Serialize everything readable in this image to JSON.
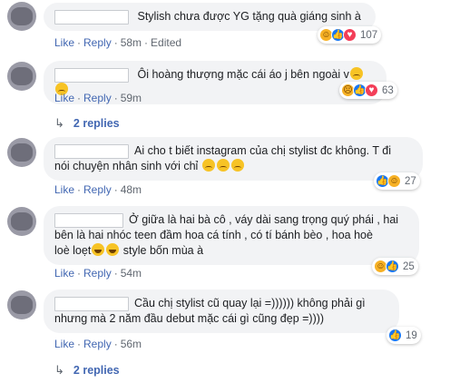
{
  "actions": {
    "like": "Like",
    "reply": "Reply"
  },
  "comments": [
    {
      "text": "Stylish chưa được YG tặng quà giáng sinh à",
      "time": "58m",
      "edited": "Edited",
      "reactions": [
        "haha",
        "like",
        "love"
      ],
      "count": "107"
    },
    {
      "text": "Ôi hoàng thượng mặc cái áo j bên ngoài v",
      "time": "59m",
      "reactions": [
        "sad",
        "like",
        "love"
      ],
      "count": "63",
      "replies": "2 replies"
    },
    {
      "text_line1": "Ai cho t biết instagram của chị stylist đc không. T đi",
      "text_line2": "nói chuyện nhân sinh với chỉ",
      "time": "48m",
      "reactions": [
        "like",
        "haha"
      ],
      "count": "27"
    },
    {
      "text_line1": "Ở giữa là hai bà cô , váy dài sang trọng quý phái , hai",
      "text_line2": "bên là hai nhóc teen đầm hoa cá tính , có tí bánh bèo , hoa hoè",
      "text_line3a": "loè loẹt",
      "text_line3b": "style bốn mùa à",
      "time": "54m",
      "reactions": [
        "haha",
        "like"
      ],
      "count": "25"
    },
    {
      "text_line1": "Cầu chị stylist cũ quay lại =)))))) không phải gì",
      "text_line2": "nhưng mà 2 năm đầu debut mặc cái gì cũng đẹp =))))",
      "time": "56m",
      "reactions": [
        "like"
      ],
      "count": "19",
      "replies": "2 replies"
    }
  ]
}
